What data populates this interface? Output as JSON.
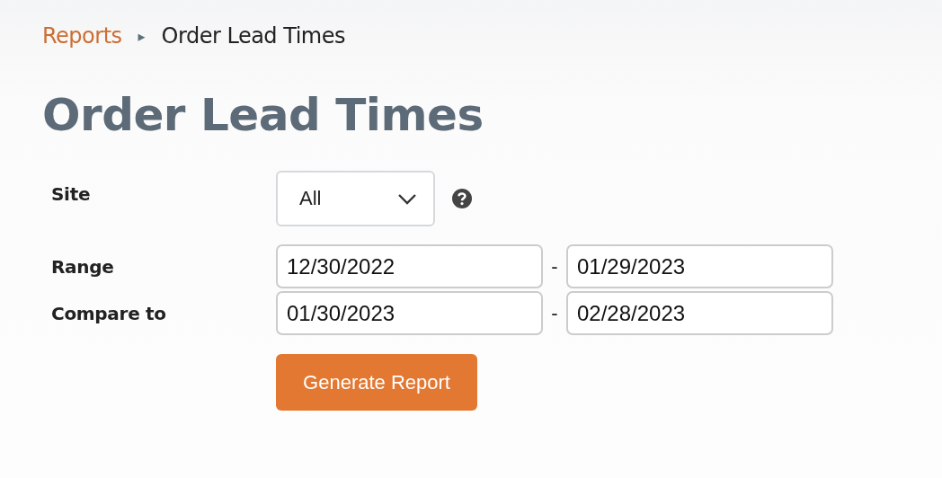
{
  "breadcrumb": {
    "link": "Reports",
    "separator": "▸",
    "current": "Order Lead Times"
  },
  "title": "Order Lead Times",
  "form": {
    "site": {
      "label": "Site",
      "value": "All"
    },
    "ranges": [
      {
        "label": "Range",
        "start": "12/30/2022",
        "separator": "-",
        "end": "01/29/2023"
      },
      {
        "label": "Compare to",
        "start": "01/30/2023",
        "separator": "-",
        "end": "02/28/2023"
      }
    ],
    "button": "Generate Report"
  }
}
